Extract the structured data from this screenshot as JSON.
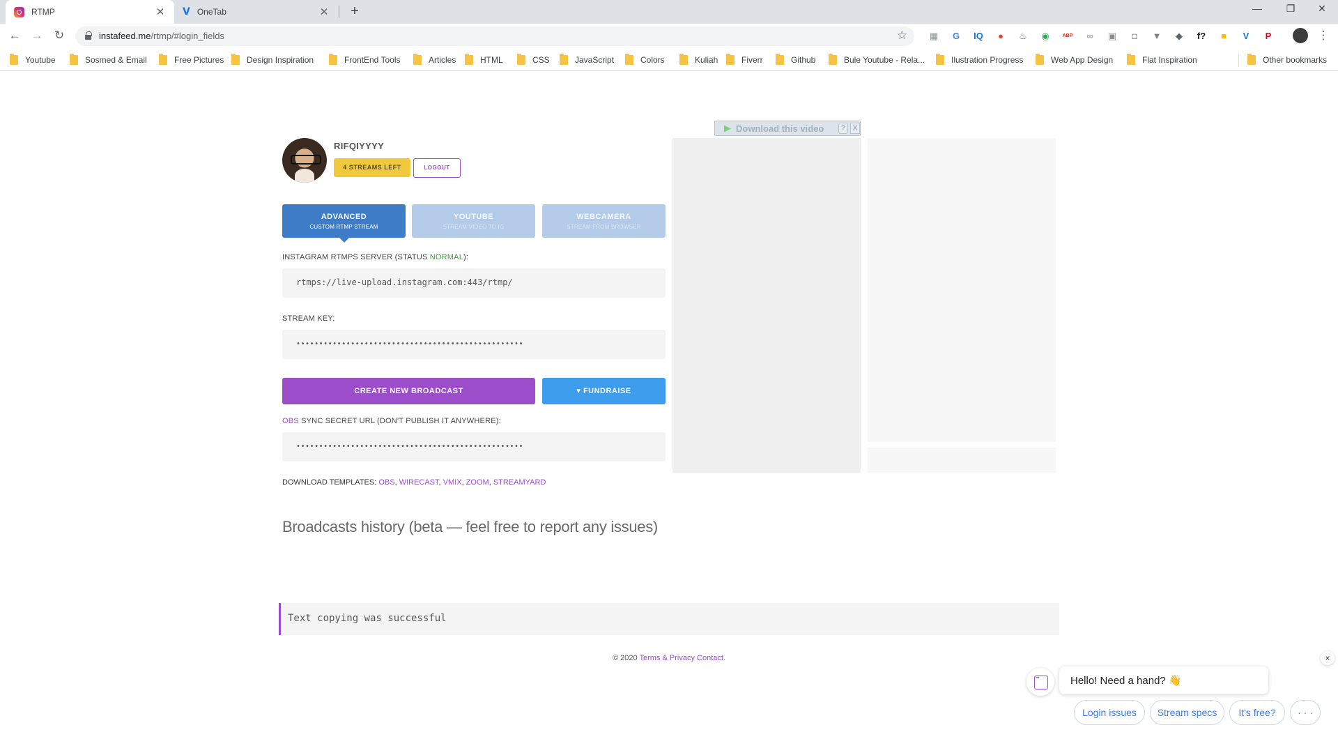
{
  "browser": {
    "tabs": [
      {
        "title": "RTMP",
        "icon": "instagram-icon"
      },
      {
        "title": "OneTab",
        "icon": "onetab-icon"
      }
    ],
    "new_tab": "+",
    "close_glyph": "✕",
    "window": {
      "minimize": "—",
      "restore": "❐",
      "close": "✕"
    },
    "nav": {
      "back": "←",
      "forward": "→",
      "reload": "↻"
    },
    "url": {
      "host": "instafeed.me",
      "path": "/rtmp/#login_fields"
    },
    "star": "☆",
    "extensions": [
      {
        "name": "tools-ext-icon",
        "label": "▦",
        "color": "#8a8f96"
      },
      {
        "name": "translate-ext-icon",
        "label": "G",
        "color": "#4285f4"
      },
      {
        "name": "iq-ext-icon",
        "label": "IQ",
        "color": "#1a73e8"
      },
      {
        "name": "colorpicker-ext-icon",
        "label": "●",
        "color": "#e94235"
      },
      {
        "name": "fire-ext-icon",
        "label": "♨",
        "color": "#5f6368"
      },
      {
        "name": "world-ext-icon",
        "label": "◉",
        "color": "#34a853"
      },
      {
        "name": "adblock-ext-icon",
        "label": "ABP",
        "color": "#d93025"
      },
      {
        "name": "vr-ext-icon",
        "label": "∞",
        "color": "#9aa0a6"
      },
      {
        "name": "window-ext-icon",
        "label": "▣",
        "color": "#8a8f96"
      },
      {
        "name": "camera-ext-icon",
        "label": "◘",
        "color": "#9aa0a6"
      },
      {
        "name": "vue-ext-icon",
        "label": "▼",
        "color": "#7b8087"
      },
      {
        "name": "location-ext-icon",
        "label": "◆",
        "color": "#5f6368"
      },
      {
        "name": "whatfont-ext-icon",
        "label": "f?",
        "color": "#202124"
      },
      {
        "name": "palette-ext-icon",
        "label": "■",
        "color": "#fbbc04"
      },
      {
        "name": "vimeo-ext-icon",
        "label": "V",
        "color": "#1a73e8"
      },
      {
        "name": "pinterest-ext-icon",
        "label": "P",
        "color": "#e60023"
      }
    ],
    "menu": "⋮",
    "bookmarks": [
      "Youtube",
      "Sosmed & Email",
      "Free Pictures",
      "Design Inspiration",
      "FrontEnd Tools",
      "Articles",
      "HTML",
      "CSS",
      "JavaScript",
      "Colors",
      "Kuliah",
      "Fiverr",
      "Github",
      "Bule Youtube - Rela...",
      "Ilustration Progress",
      "Web App Design",
      "Flat Inspiration"
    ],
    "other_bookmarks": "Other bookmarks"
  },
  "profile": {
    "username": "RIFQIYYYY",
    "streams_left": "4 STREAMS LEFT",
    "logout": "LOGOUT"
  },
  "modes": [
    {
      "title": "ADVANCED",
      "subtitle": "CUSTOM RTMP STREAM",
      "active": true
    },
    {
      "title": "YOUTUBE",
      "subtitle": "STREAM VIDEO TO IG",
      "active": false
    },
    {
      "title": "WEBCAMERA",
      "subtitle": "STREAM FROM BROWSER",
      "active": false
    }
  ],
  "server": {
    "label_prefix": "INSTAGRAM RTMPS SERVER (STATUS ",
    "status": "NORMAL",
    "label_suffix": "):",
    "value": "rtmps://live-upload.instagram.com:443/rtmp/"
  },
  "stream_key": {
    "label": "STREAM KEY:",
    "value": "••••••••••••••••••••••••••••••••••••••••••••••••••"
  },
  "actions": {
    "create": "CREATE NEW BROADCAST",
    "fundraise": "▾ FUNDRAISE"
  },
  "obs_sync": {
    "label_link": "OBS",
    "label_rest": " SYNC SECRET URL (DON'T PUBLISH IT ANYWHERE):",
    "value": "••••••••••••••••••••••••••••••••••••••••••••••••••"
  },
  "templates": {
    "label": "DOWNLOAD TEMPLATES: ",
    "items": [
      "OBS",
      "WIRECAST",
      "VMIX",
      "ZOOM",
      "STREAMYARD"
    ]
  },
  "history_title": "Broadcasts history (beta — feel free to report any issues)",
  "download_overlay": {
    "text": "Download this video",
    "help": "?",
    "close": "X"
  },
  "toast": "Text copying was successful",
  "footer": {
    "copyright": "© 2020 ",
    "terms": "Terms & Privacy",
    "contact": "Contact."
  },
  "chat": {
    "greeting": "Hello! Need a hand? 👋",
    "close": "×",
    "chips": [
      "Login issues",
      "Stream specs",
      "It's free?",
      "· · ·"
    ]
  }
}
